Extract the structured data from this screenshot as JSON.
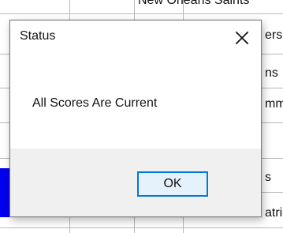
{
  "background": {
    "top_text": "New Orleans Saints",
    "right_fragments": [
      "ers",
      "ns",
      "mma",
      "s",
      "atric"
    ],
    "blue_color": "#0000ee"
  },
  "dialog": {
    "title": "Status",
    "close_icon": "close-icon",
    "message": "All Scores Are Current",
    "ok_label": "OK",
    "accent": "#0078d7"
  }
}
